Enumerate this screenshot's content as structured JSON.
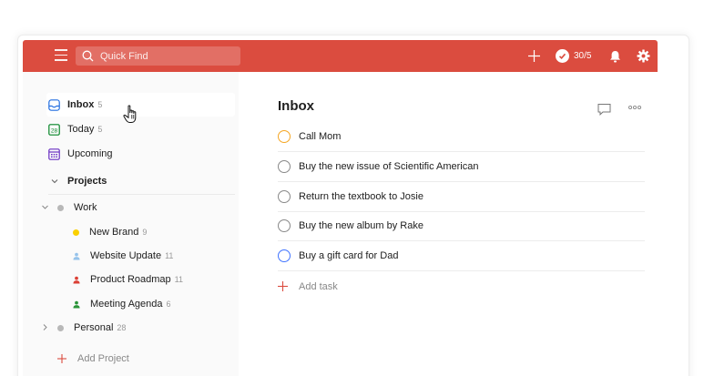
{
  "colors": {
    "accent": "#db4c3f",
    "priority1": "#f5a623",
    "priority2": "#4073ff"
  },
  "header": {
    "search_placeholder": "Quick Find",
    "karma": "30/5"
  },
  "sidebar": {
    "filters": [
      {
        "label": "Inbox",
        "count": "5",
        "icon": "inbox-icon"
      },
      {
        "label": "Today",
        "count": "5",
        "icon": "calendar-today-icon"
      },
      {
        "label": "Upcoming",
        "count": "",
        "icon": "calendar-upcoming-icon"
      }
    ],
    "projects_label": "Projects",
    "projects": [
      {
        "label": "Work",
        "count": "",
        "color": "#b8b8b8"
      },
      {
        "label": "New Brand",
        "count": "9",
        "color": "#fad000"
      },
      {
        "label": "Website Update",
        "count": "11",
        "color": "#96c3eb"
      },
      {
        "label": "Product Roadmap",
        "count": "11",
        "color": "#db4035"
      },
      {
        "label": "Meeting Agenda",
        "count": "6",
        "color": "#299438"
      },
      {
        "label": "Personal",
        "count": "28",
        "color": "#b8b8b8"
      }
    ],
    "add_project": "Add Project"
  },
  "main": {
    "title": "Inbox",
    "tasks": [
      {
        "label": "Call Mom",
        "ring": "#f5a623"
      },
      {
        "label": "Buy the new issue of Scientific American",
        "ring": "#888888"
      },
      {
        "label": "Return the textbook to Josie",
        "ring": "#888888"
      },
      {
        "label": "Buy the new album by Rake",
        "ring": "#888888"
      },
      {
        "label": "Buy a gift card for Dad",
        "ring": "#4073ff"
      }
    ],
    "add_task": "Add task"
  }
}
